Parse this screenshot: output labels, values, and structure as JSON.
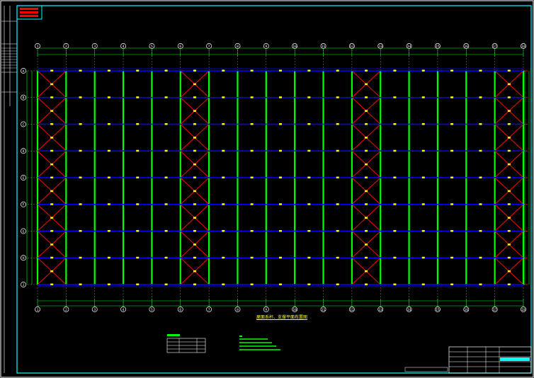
{
  "drawing": {
    "title": "屋面系杆、支撑平面布置图",
    "axes_horizontal": [
      "1",
      "2",
      "3",
      "4",
      "5",
      "6",
      "7",
      "8",
      "9",
      "10",
      "11",
      "12",
      "13",
      "14",
      "15",
      "16",
      "17",
      "18"
    ],
    "axes_vertical": [
      "A",
      "B",
      "C",
      "D",
      "E",
      "F",
      "G",
      "H",
      "J"
    ],
    "braced_bays": [
      1,
      6,
      12,
      17
    ]
  },
  "colors": {
    "frame": "#00ffff",
    "rafter": "#00ff00",
    "purlin": "#0000ff",
    "brace": "#ff0000",
    "label": "#ffff00",
    "dim": "#00ff00",
    "grid": "#b0b0b0"
  },
  "icons": {
    "axis_bubble": "circle-icon",
    "tie_marker": "tag-icon"
  }
}
